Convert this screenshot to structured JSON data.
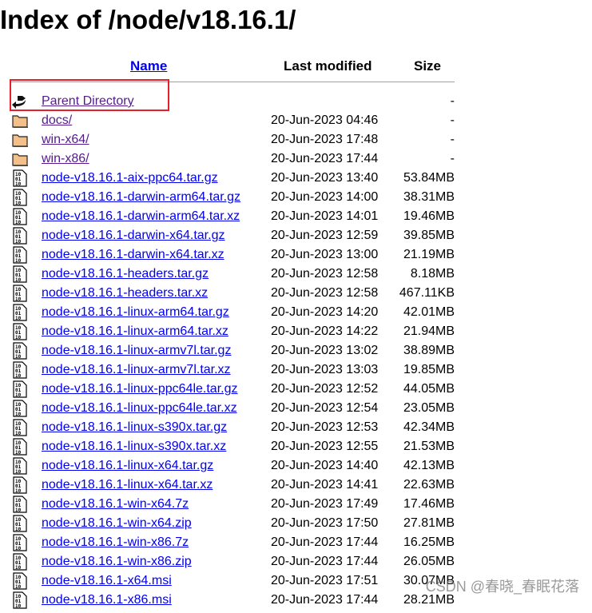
{
  "title": "Index of /node/v18.16.1/",
  "columns": {
    "name": "Name",
    "modified": "Last modified",
    "size": "Size"
  },
  "colors": {
    "link": "#0000ee",
    "visited": "#551a8b",
    "highlight_box": "#e5202a"
  },
  "rows": [
    {
      "icon": "back-icon",
      "name": "Parent Directory",
      "date": "",
      "size": "-",
      "visited": true
    },
    {
      "icon": "folder-icon",
      "name": "docs/",
      "date": "20-Jun-2023 04:46",
      "size": "-",
      "visited": true
    },
    {
      "icon": "folder-icon",
      "name": "win-x64/",
      "date": "20-Jun-2023 17:48",
      "size": "-",
      "visited": true
    },
    {
      "icon": "folder-icon",
      "name": "win-x86/",
      "date": "20-Jun-2023 17:44",
      "size": "-",
      "visited": true
    },
    {
      "icon": "binary-file-icon",
      "name": "node-v18.16.1-aix-ppc64.tar.gz",
      "date": "20-Jun-2023 13:40",
      "size": "53.84MB"
    },
    {
      "icon": "binary-file-icon",
      "name": "node-v18.16.1-darwin-arm64.tar.gz",
      "date": "20-Jun-2023 14:00",
      "size": "38.31MB"
    },
    {
      "icon": "binary-file-icon",
      "name": "node-v18.16.1-darwin-arm64.tar.xz",
      "date": "20-Jun-2023 14:01",
      "size": "19.46MB"
    },
    {
      "icon": "binary-file-icon",
      "name": "node-v18.16.1-darwin-x64.tar.gz",
      "date": "20-Jun-2023 12:59",
      "size": "39.85MB"
    },
    {
      "icon": "binary-file-icon",
      "name": "node-v18.16.1-darwin-x64.tar.xz",
      "date": "20-Jun-2023 13:00",
      "size": "21.19MB"
    },
    {
      "icon": "binary-file-icon",
      "name": "node-v18.16.1-headers.tar.gz",
      "date": "20-Jun-2023 12:58",
      "size": "8.18MB"
    },
    {
      "icon": "binary-file-icon",
      "name": "node-v18.16.1-headers.tar.xz",
      "date": "20-Jun-2023 12:58",
      "size": "467.11KB"
    },
    {
      "icon": "binary-file-icon",
      "name": "node-v18.16.1-linux-arm64.tar.gz",
      "date": "20-Jun-2023 14:20",
      "size": "42.01MB"
    },
    {
      "icon": "binary-file-icon",
      "name": "node-v18.16.1-linux-arm64.tar.xz",
      "date": "20-Jun-2023 14:22",
      "size": "21.94MB"
    },
    {
      "icon": "binary-file-icon",
      "name": "node-v18.16.1-linux-armv7l.tar.gz",
      "date": "20-Jun-2023 13:02",
      "size": "38.89MB"
    },
    {
      "icon": "binary-file-icon",
      "name": "node-v18.16.1-linux-armv7l.tar.xz",
      "date": "20-Jun-2023 13:03",
      "size": "19.85MB"
    },
    {
      "icon": "binary-file-icon",
      "name": "node-v18.16.1-linux-ppc64le.tar.gz",
      "date": "20-Jun-2023 12:52",
      "size": "44.05MB"
    },
    {
      "icon": "binary-file-icon",
      "name": "node-v18.16.1-linux-ppc64le.tar.xz",
      "date": "20-Jun-2023 12:54",
      "size": "23.05MB"
    },
    {
      "icon": "binary-file-icon",
      "name": "node-v18.16.1-linux-s390x.tar.gz",
      "date": "20-Jun-2023 12:53",
      "size": "42.34MB"
    },
    {
      "icon": "binary-file-icon",
      "name": "node-v18.16.1-linux-s390x.tar.xz",
      "date": "20-Jun-2023 12:55",
      "size": "21.53MB"
    },
    {
      "icon": "binary-file-icon",
      "name": "node-v18.16.1-linux-x64.tar.gz",
      "date": "20-Jun-2023 14:40",
      "size": "42.13MB"
    },
    {
      "icon": "binary-file-icon",
      "name": "node-v18.16.1-linux-x64.tar.xz",
      "date": "20-Jun-2023 14:41",
      "size": "22.63MB"
    },
    {
      "icon": "binary-file-icon",
      "name": "node-v18.16.1-win-x64.7z",
      "date": "20-Jun-2023 17:49",
      "size": "17.46MB"
    },
    {
      "icon": "binary-file-icon",
      "name": "node-v18.16.1-win-x64.zip",
      "date": "20-Jun-2023 17:50",
      "size": "27.81MB"
    },
    {
      "icon": "binary-file-icon",
      "name": "node-v18.16.1-win-x86.7z",
      "date": "20-Jun-2023 17:44",
      "size": "16.25MB"
    },
    {
      "icon": "binary-file-icon",
      "name": "node-v18.16.1-win-x86.zip",
      "date": "20-Jun-2023 17:44",
      "size": "26.05MB"
    },
    {
      "icon": "binary-file-icon",
      "name": "node-v18.16.1-x64.msi",
      "date": "20-Jun-2023 17:51",
      "size": "30.07MB"
    },
    {
      "icon": "binary-file-icon",
      "name": "node-v18.16.1-x86.msi",
      "date": "20-Jun-2023 17:44",
      "size": "28.21MB"
    }
  ],
  "watermark": "CSDN @春晓_春眠花落"
}
